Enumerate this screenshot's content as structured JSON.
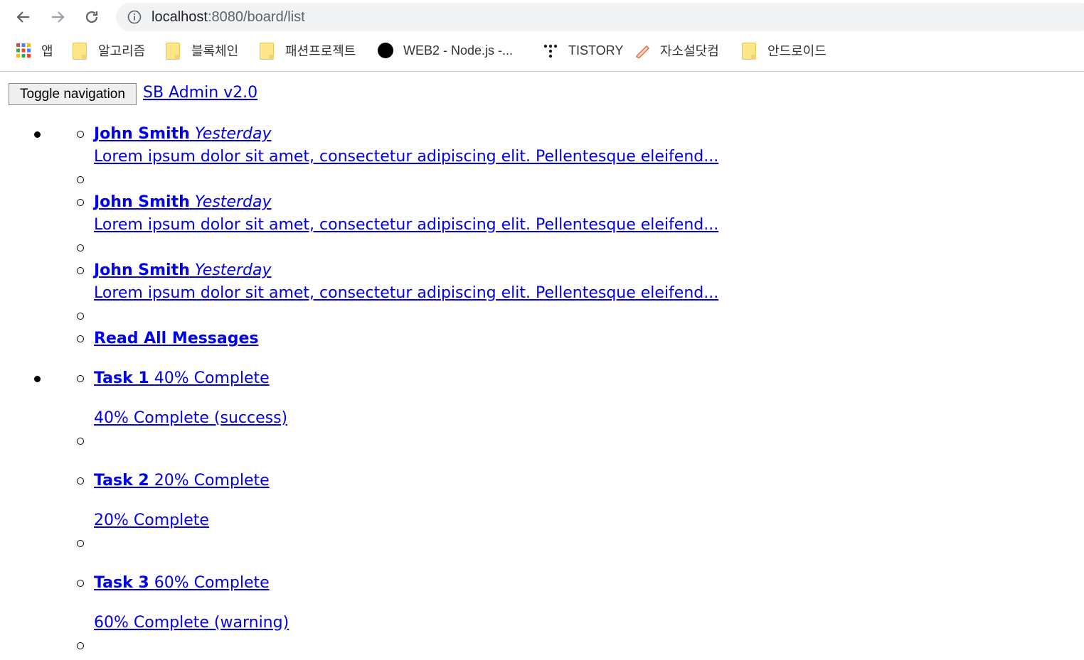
{
  "browser": {
    "url_host": "localhost",
    "url_path": ":8080/board/list",
    "bookmarks": [
      {
        "label": "앱",
        "icon": "apps-grid-icon"
      },
      {
        "label": "알고리즘",
        "icon": "folder-icon"
      },
      {
        "label": "블록체인",
        "icon": "folder-icon"
      },
      {
        "label": "패션프로젝트",
        "icon": "folder-icon"
      },
      {
        "label": "WEB2 - Node.js -...",
        "icon": "black-circle-icon"
      },
      {
        "label": "TISTORY",
        "icon": "tistory-icon"
      },
      {
        "label": "자소설닷컴",
        "icon": "pencil-icon"
      },
      {
        "label": "안드로이드",
        "icon": "folder-icon"
      }
    ]
  },
  "navbar": {
    "toggle_label": "Toggle navigation",
    "brand": "SB Admin v2.0"
  },
  "messages": [
    {
      "name": "John Smith",
      "time": "Yesterday",
      "body": "Lorem ipsum dolor sit amet, consectetur adipiscing elit. Pellentesque eleifend..."
    },
    {
      "name": "John Smith",
      "time": "Yesterday",
      "body": "Lorem ipsum dolor sit amet, consectetur adipiscing elit. Pellentesque eleifend..."
    },
    {
      "name": "John Smith",
      "time": "Yesterday",
      "body": "Lorem ipsum dolor sit amet, consectetur adipiscing elit. Pellentesque eleifend..."
    }
  ],
  "read_all": "Read All Messages",
  "tasks": [
    {
      "name": "Task 1",
      "complete": "40% Complete",
      "progress": "40% Complete (success)"
    },
    {
      "name": "Task 2",
      "complete": "20% Complete",
      "progress": "20% Complete"
    },
    {
      "name": "Task 3",
      "complete": "60% Complete",
      "progress": "60% Complete (warning)"
    }
  ]
}
